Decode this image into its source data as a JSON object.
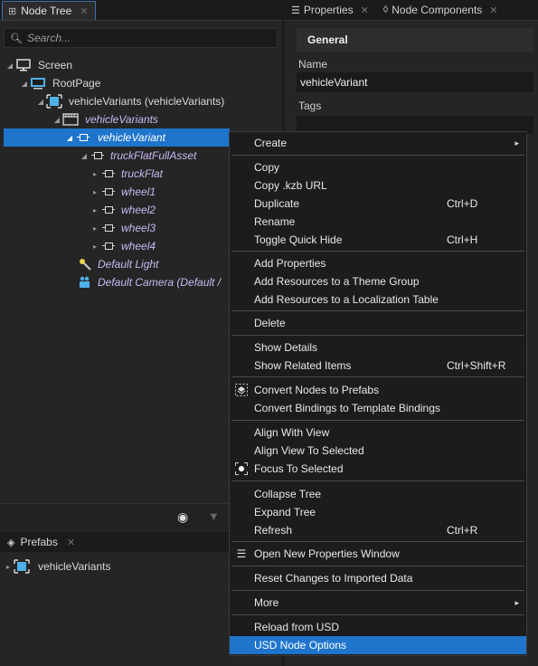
{
  "node_tree": {
    "tab_label": "Node Tree",
    "search_placeholder": "Search...",
    "items": [
      {
        "label": "Screen"
      },
      {
        "label": "RootPage"
      },
      {
        "label": "vehicleVariants (vehicleVariants)"
      },
      {
        "label": "vehicleVariants"
      },
      {
        "label": "vehicleVariant"
      },
      {
        "label": "truckFlatFullAsset"
      },
      {
        "label": "truckFlat"
      },
      {
        "label": "wheel1"
      },
      {
        "label": "wheel2"
      },
      {
        "label": "wheel3"
      },
      {
        "label": "wheel4"
      },
      {
        "label": "Default Light"
      },
      {
        "label": "Default Camera (Default /"
      }
    ]
  },
  "prefabs": {
    "tab_label": "Prefabs",
    "items": [
      {
        "label": "vehicleVariants"
      }
    ]
  },
  "properties": {
    "tab_label": "Properties",
    "tab2_label": "Node Components",
    "section_title": "General",
    "name_label": "Name",
    "name_value": "vehicleVariant",
    "tags_label": "Tags"
  },
  "context_menu": {
    "items": [
      {
        "label": "Create",
        "shortcut": "",
        "submenu": "▸"
      },
      {
        "label": "Copy",
        "shortcut": ""
      },
      {
        "label": "Copy .kzb URL",
        "shortcut": ""
      },
      {
        "label": "Duplicate",
        "shortcut": "Ctrl+D"
      },
      {
        "label": "Rename",
        "shortcut": ""
      },
      {
        "label": "Toggle Quick Hide",
        "shortcut": "Ctrl+H"
      },
      {
        "label": "Add Properties",
        "shortcut": ""
      },
      {
        "label": "Add Resources to a Theme Group",
        "shortcut": ""
      },
      {
        "label": "Add Resources to a Localization Table",
        "shortcut": ""
      },
      {
        "label": "Delete",
        "shortcut": ""
      },
      {
        "label": "Show Details",
        "shortcut": ""
      },
      {
        "label": "Show Related Items",
        "shortcut": "Ctrl+Shift+R"
      },
      {
        "label": "Convert Nodes to Prefabs",
        "shortcut": ""
      },
      {
        "label": "Convert Bindings to Template Bindings",
        "shortcut": ""
      },
      {
        "label": "Align With View",
        "shortcut": ""
      },
      {
        "label": "Align View To Selected",
        "shortcut": ""
      },
      {
        "label": "Focus To Selected",
        "shortcut": ""
      },
      {
        "label": "Collapse Tree",
        "shortcut": ""
      },
      {
        "label": "Expand Tree",
        "shortcut": ""
      },
      {
        "label": "Refresh",
        "shortcut": "Ctrl+R"
      },
      {
        "label": "Open New Properties Window",
        "shortcut": ""
      },
      {
        "label": "Reset Changes to Imported Data",
        "shortcut": ""
      },
      {
        "label": "More",
        "shortcut": "",
        "submenu": "▸"
      },
      {
        "label": "Reload from USD",
        "shortcut": ""
      },
      {
        "label": "USD Node Options",
        "shortcut": ""
      }
    ]
  },
  "colors": {
    "selection": "#1f75cc",
    "accent_icon": "#4fb0e8",
    "background": "#1e1e1e"
  }
}
